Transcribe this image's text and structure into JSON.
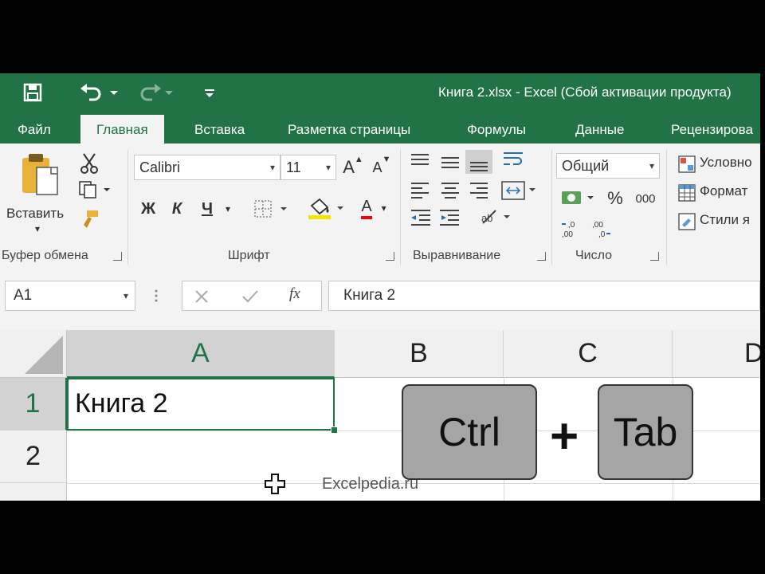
{
  "window": {
    "title": "Книга 2.xlsx - Excel (Сбой активации продукта)",
    "accent": "#217346"
  },
  "qat": {
    "icons": [
      "save-icon",
      "undo-icon",
      "redo-icon",
      "customize-icon"
    ]
  },
  "tabs": [
    {
      "label": "Файл"
    },
    {
      "label": "Главная",
      "active": true
    },
    {
      "label": "Вставка"
    },
    {
      "label": "Разметка страницы"
    },
    {
      "label": "Формулы"
    },
    {
      "label": "Данные"
    },
    {
      "label": "Рецензирова"
    }
  ],
  "ribbon": {
    "clipboard": {
      "paste_label": "Вставить",
      "group_label": "Буфер обмена"
    },
    "font": {
      "name": "Calibri",
      "size": "11",
      "bold": "Ж",
      "italic": "К",
      "underline": "Ч",
      "grow": "A",
      "shrink": "A",
      "color_letter": "A",
      "group_label": "Шрифт"
    },
    "alignment": {
      "group_label": "Выравнивание"
    },
    "number": {
      "format": "Общий",
      "percent": "%",
      "thousands": "000",
      "group_label": "Число"
    },
    "styles": {
      "conditional": "Условно",
      "format_table": "Формат",
      "cell_styles": "Стили я"
    }
  },
  "formula_bar": {
    "name_box": "A1",
    "content": "Книга 2",
    "fx": "fx"
  },
  "grid": {
    "columns": [
      "A",
      "B",
      "C",
      "D"
    ],
    "rows": [
      "1",
      "2"
    ],
    "a1_value": "Книга 2"
  },
  "overlay": {
    "key1": "Ctrl",
    "plus": "+",
    "key2": "Tab",
    "watermark": "Excelpedia.ru"
  }
}
